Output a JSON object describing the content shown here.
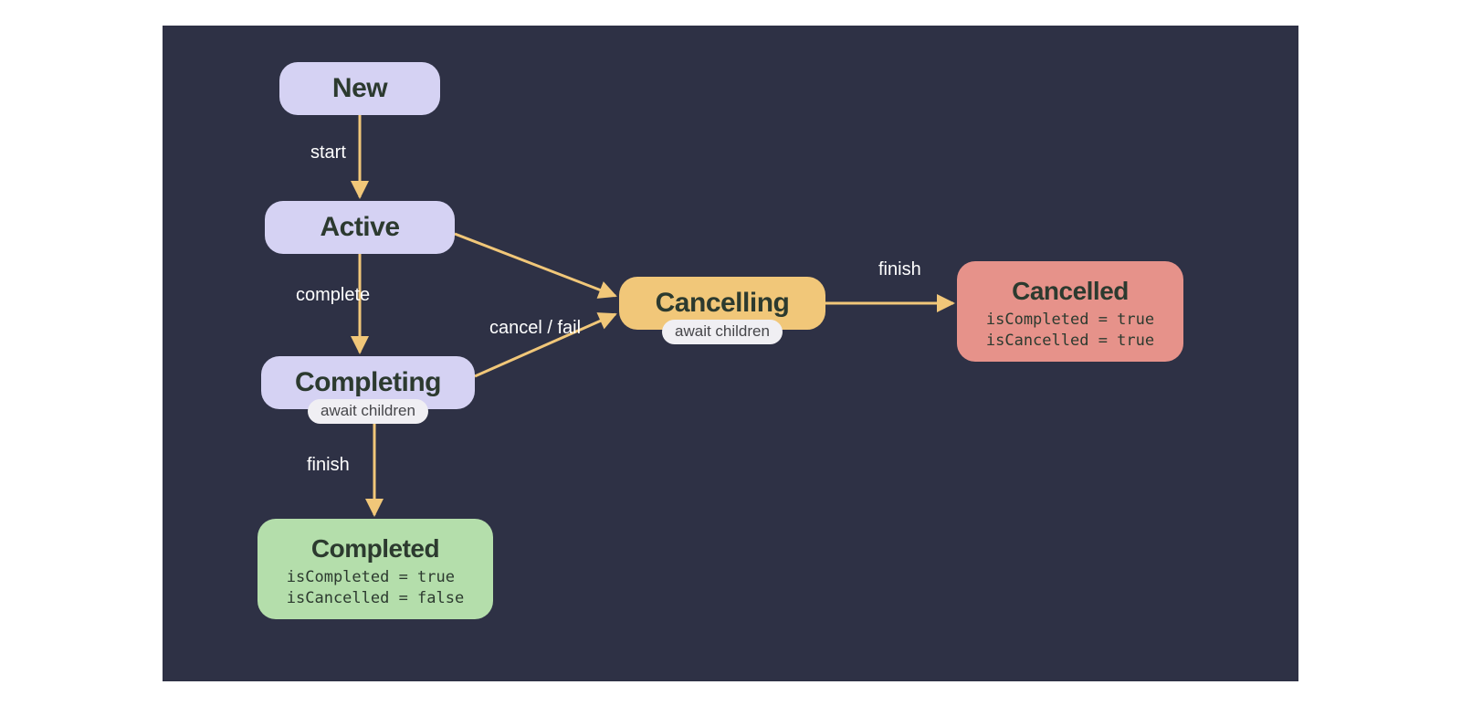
{
  "nodes": {
    "new": {
      "title": "New"
    },
    "active": {
      "title": "Active"
    },
    "completing": {
      "title": "Completing",
      "sublabel": "await children"
    },
    "completed": {
      "title": "Completed",
      "line1": "isCompleted = true",
      "line2": "isCancelled = false"
    },
    "cancelling": {
      "title": "Cancelling",
      "sublabel": "await children"
    },
    "cancelled": {
      "title": "Cancelled",
      "line1": "isCompleted = true",
      "line2": "isCancelled = true"
    }
  },
  "edges": {
    "start": "start",
    "complete": "complete",
    "finish1": "finish",
    "cancelfail": "cancel / fail",
    "finish2": "finish"
  }
}
